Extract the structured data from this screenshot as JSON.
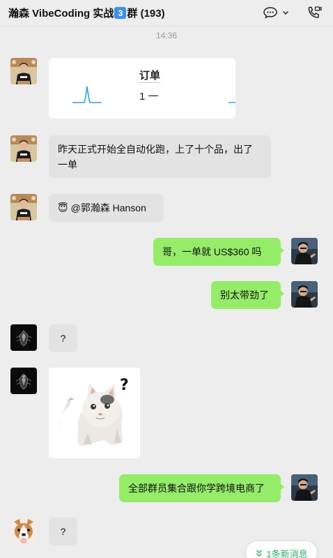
{
  "header": {
    "title_part1": "瀚森 VibeCoding 实战",
    "badge": "3",
    "title_part2": "群 (193)"
  },
  "timestamp": "14:36",
  "order_card": {
    "title": "订单",
    "value": "1 一"
  },
  "messages": [
    {
      "side": "left",
      "text": "昨天正式开始全自动化跑，上了十个品，出了一单"
    },
    {
      "side": "left",
      "emoji": "😇",
      "text": "@郭瀚森 Hanson"
    },
    {
      "side": "right",
      "text": "哥，一单就 US$360 吗"
    },
    {
      "side": "right",
      "text": "别太带劲了"
    },
    {
      "side": "left",
      "text": "?"
    },
    {
      "side": "right",
      "text": "全部群员集合跟你学跨境电商了"
    },
    {
      "side": "left",
      "text": "?"
    }
  ],
  "sticker": {
    "glyph": "?"
  },
  "new_messages": {
    "label": "1条新消息"
  },
  "colors": {
    "bubble_self": "#95ec69",
    "bubble_other": "#e3e3e3",
    "background": "#ededed",
    "accent_green": "#2aae67",
    "chart_line": "#2ea4d8"
  }
}
